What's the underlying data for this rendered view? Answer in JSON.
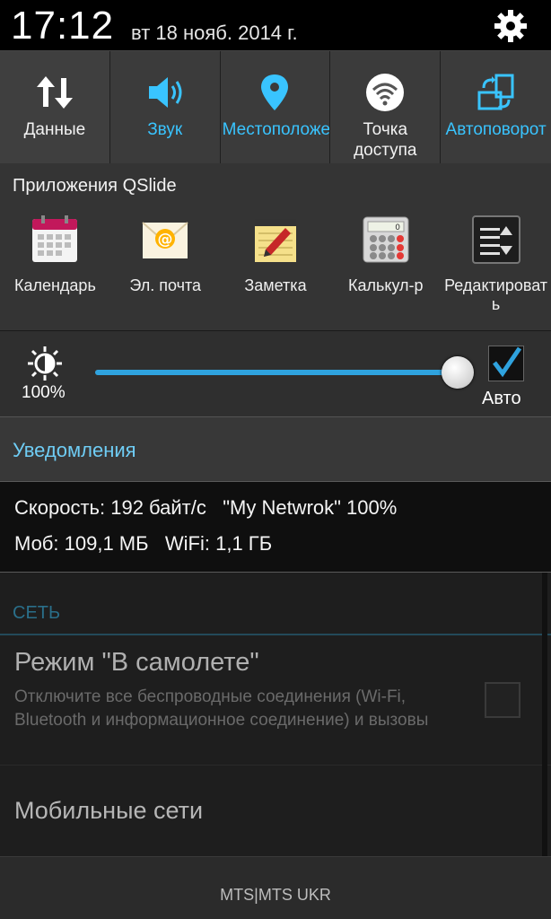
{
  "status": {
    "time": "17:12",
    "date": "вт 18 нояб. 2014 г."
  },
  "toggles": [
    {
      "label": "Данные",
      "icon": "data-arrows-icon",
      "active": false
    },
    {
      "label": "Звук",
      "icon": "speaker-icon",
      "active": true
    },
    {
      "label": "Местоположение",
      "icon": "location-pin-icon",
      "active": true
    },
    {
      "label": "Точка доступа",
      "icon": "wifi-hotspot-icon",
      "active": false
    },
    {
      "label": "Автоповорот",
      "icon": "auto-rotate-icon",
      "active": true
    }
  ],
  "qslide": {
    "title": "Приложения QSlide",
    "apps": [
      {
        "label": "Календарь",
        "icon": "calendar-icon"
      },
      {
        "label": "Эл. почта",
        "icon": "email-icon"
      },
      {
        "label": "Заметка",
        "icon": "notepad-icon"
      },
      {
        "label": "Калькул-р",
        "icon": "calculator-icon"
      },
      {
        "label": "Редактировать",
        "icon": "edit-list-icon"
      }
    ]
  },
  "brightness": {
    "percent_label": "100%",
    "level": 1.0,
    "auto_label": "Авто",
    "auto_checked": true
  },
  "notifications": {
    "title": "Уведомления",
    "speed_line": "Скорость: 192 байт/с   \"My Netwrok\" 100%",
    "usage_line": "Моб: 109,1 МБ   WiFi: 1,1 ГБ"
  },
  "settings": {
    "section": "СЕТЬ",
    "airplane_title": "Режим \"В самолете\"",
    "airplane_desc": "Отключите все беспроводные соединения (Wi-Fi, Bluetooth и информационное соединение) и вызовы",
    "airplane_checked": false,
    "mobile_title": "Мобильные сети"
  },
  "footer": {
    "carrier": "MTS|MTS UKR"
  },
  "colors": {
    "accent_blue": "#39c4ff",
    "slider_blue": "#2fa3df",
    "notif_title": "#6fcdf5"
  }
}
